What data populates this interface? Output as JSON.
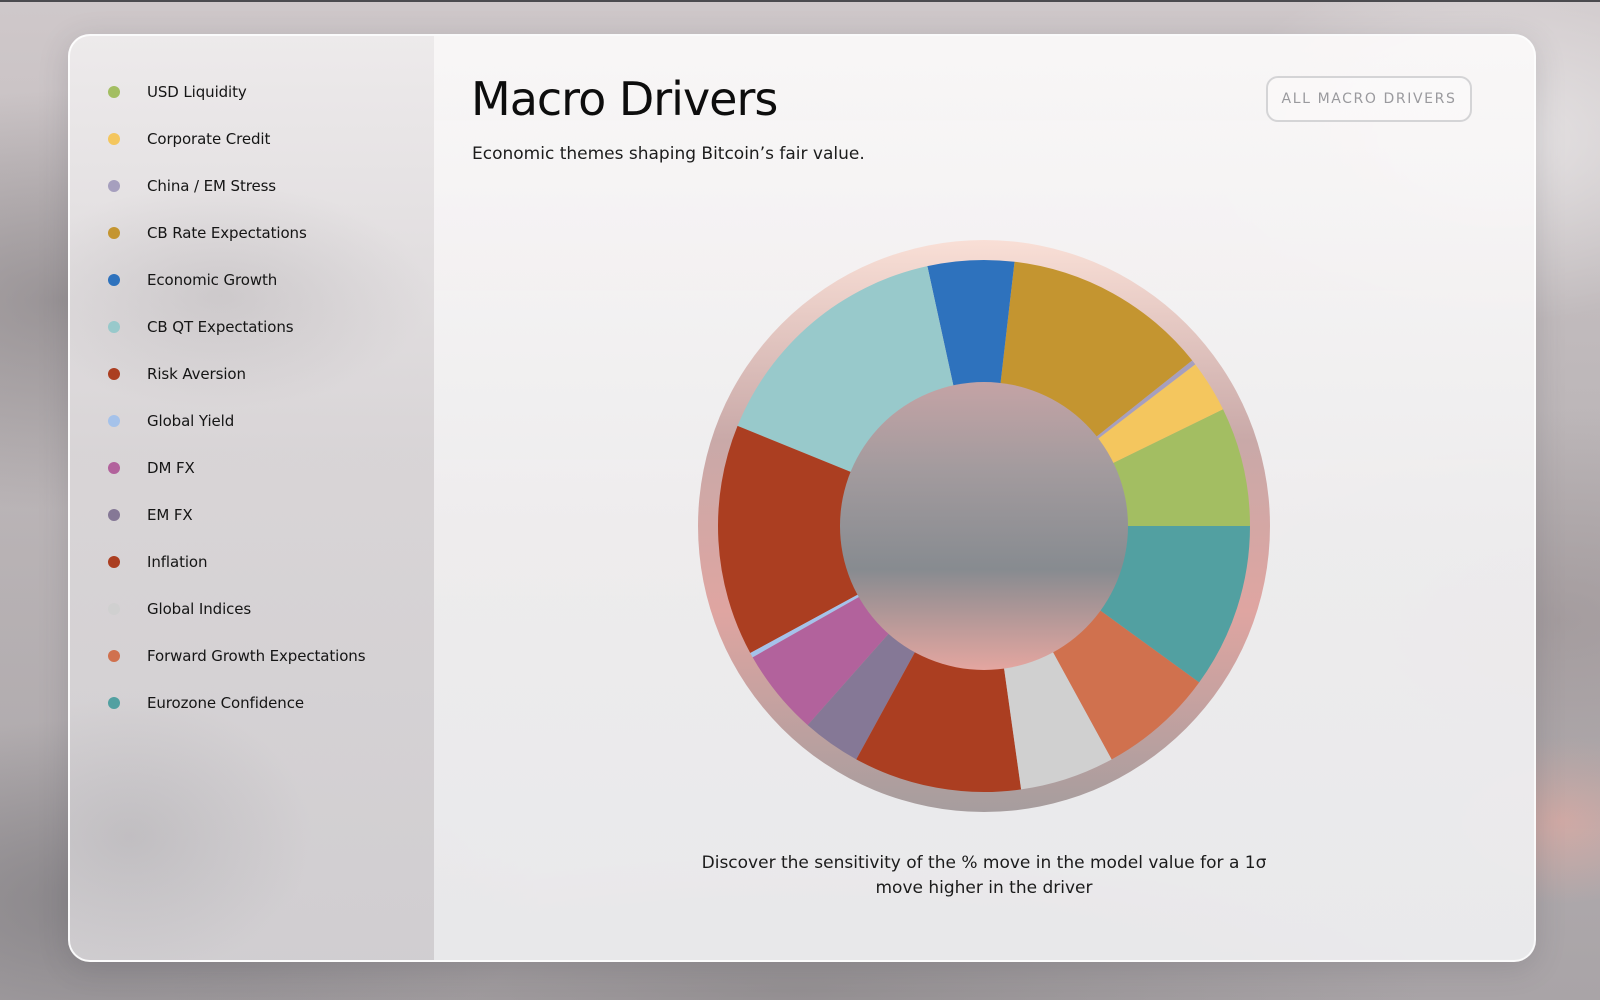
{
  "header": {
    "title": "Macro Drivers",
    "subtitle": "Economic themes shaping Bitcoin’s fair value.",
    "all_button_label": "ALL MACRO DRIVERS"
  },
  "legend": {
    "items": [
      {
        "label": "USD Liquidity",
        "color": "#a3be62"
      },
      {
        "label": "Corporate Credit",
        "color": "#f4c65e"
      },
      {
        "label": "China / EM Stress",
        "color": "#a69fbe"
      },
      {
        "label": "CB Rate Expectations",
        "color": "#c49530"
      },
      {
        "label": "Economic Growth",
        "color": "#2e72bd"
      },
      {
        "label": "CB QT Expectations",
        "color": "#98c9cb"
      },
      {
        "label": "Risk Aversion",
        "color": "#ab3e21"
      },
      {
        "label": "Global Yield",
        "color": "#a5c2ea"
      },
      {
        "label": "DM FX",
        "color": "#b2629c"
      },
      {
        "label": "EM FX",
        "color": "#857896"
      },
      {
        "label": "Inflation",
        "color": "#ab3e21"
      },
      {
        "label": "Global Indices",
        "color": "#d0d0d0"
      },
      {
        "label": "Forward Growth Expectations",
        "color": "#d0714e"
      },
      {
        "label": "Eurozone Confidence",
        "color": "#52a0a1"
      }
    ]
  },
  "caption": "Discover the sensitivity of the % move in the model value for a 1σ move higher in the driver",
  "chart_data": {
    "type": "pie",
    "variant": "donut",
    "title": "",
    "slices": [
      {
        "label": "USD Liquidity",
        "value": 7.3,
        "color": "#a3be62"
      },
      {
        "label": "Corporate Credit",
        "value": 3.2,
        "color": "#f4c65e"
      },
      {
        "label": "China / EM Stress",
        "value": 0.3,
        "color": "#a69fbe"
      },
      {
        "label": "CB Rate Expectations",
        "value": 12.6,
        "color": "#c49530"
      },
      {
        "label": "Economic Growth",
        "value": 5.3,
        "color": "#2e72bd"
      },
      {
        "label": "CB QT Expectations",
        "value": 15.6,
        "color": "#98c9cb"
      },
      {
        "label": "Risk Aversion",
        "value": 14.2,
        "color": "#ab3e21"
      },
      {
        "label": "Global Yield",
        "value": 0.3,
        "color": "#a5c2ea"
      },
      {
        "label": "DM FX",
        "value": 5.3,
        "color": "#b2629c"
      },
      {
        "label": "EM FX",
        "value": 3.6,
        "color": "#857896"
      },
      {
        "label": "Inflation",
        "value": 10.3,
        "color": "#ab3e21"
      },
      {
        "label": "Global Indices",
        "value": 5.8,
        "color": "#d0d0d0"
      },
      {
        "label": "Forward Growth Expectations",
        "value": 7.1,
        "color": "#d0714e"
      },
      {
        "label": "Eurozone Confidence",
        "value": 10.1,
        "color": "#52a0a1"
      }
    ],
    "start_angle": "3 o'clock",
    "direction": "counter-clockwise",
    "legend": "left-sidebar"
  }
}
